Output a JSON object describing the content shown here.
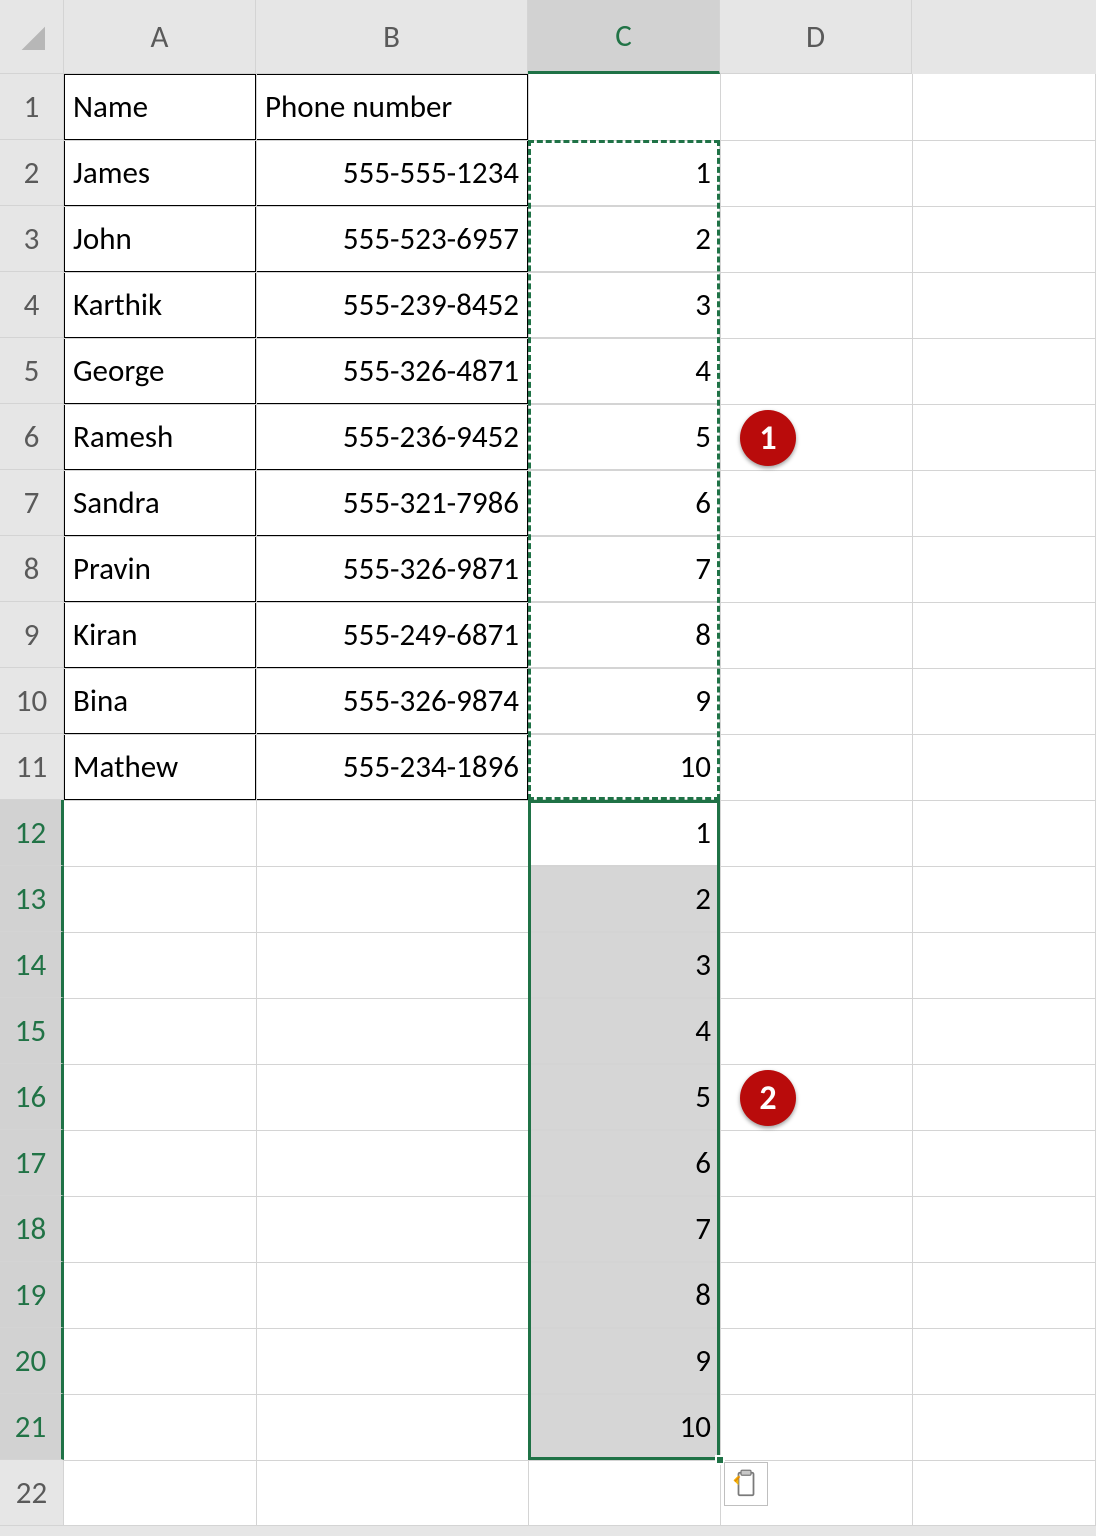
{
  "columns": [
    "A",
    "B",
    "C",
    "D"
  ],
  "rows": [
    "1",
    "2",
    "3",
    "4",
    "5",
    "6",
    "7",
    "8",
    "9",
    "10",
    "11",
    "12",
    "13",
    "14",
    "15",
    "16",
    "17",
    "18",
    "19",
    "20",
    "21",
    "22"
  ],
  "headers": {
    "A": "Name",
    "B": "Phone number"
  },
  "data_rows": [
    {
      "name": "James",
      "phone": "555-555-1234",
      "c": "1"
    },
    {
      "name": "John",
      "phone": "555-523-6957",
      "c": "2"
    },
    {
      "name": "Karthik",
      "phone": "555-239-8452",
      "c": "3"
    },
    {
      "name": "George",
      "phone": "555-326-4871",
      "c": "4"
    },
    {
      "name": "Ramesh",
      "phone": "555-236-9452",
      "c": "5"
    },
    {
      "name": "Sandra",
      "phone": "555-321-7986",
      "c": "6"
    },
    {
      "name": "Pravin",
      "phone": "555-326-9871",
      "c": "7"
    },
    {
      "name": "Kiran",
      "phone": "555-249-6871",
      "c": "8"
    },
    {
      "name": "Bina",
      "phone": "555-326-9874",
      "c": "9"
    },
    {
      "name": "Mathew",
      "phone": "555-234-1896",
      "c": "10"
    }
  ],
  "pasted_c": [
    "1",
    "2",
    "3",
    "4",
    "5",
    "6",
    "7",
    "8",
    "9",
    "10"
  ],
  "callouts": {
    "one": "1",
    "two": "2"
  },
  "selected_column": "C",
  "chart_data": {
    "type": "table",
    "columns": [
      "Name",
      "Phone number",
      "C"
    ],
    "rows": [
      [
        "James",
        "555-555-1234",
        1
      ],
      [
        "John",
        "555-523-6957",
        2
      ],
      [
        "Karthik",
        "555-239-8452",
        3
      ],
      [
        "George",
        "555-326-4871",
        4
      ],
      [
        "Ramesh",
        "555-236-9452",
        5
      ],
      [
        "Sandra",
        "555-321-7986",
        6
      ],
      [
        "Pravin",
        "555-326-9871",
        7
      ],
      [
        "Kiran",
        "555-249-6871",
        8
      ],
      [
        "Bina",
        "555-326-9874",
        9
      ],
      [
        "Mathew",
        "555-234-1896",
        10
      ]
    ]
  }
}
